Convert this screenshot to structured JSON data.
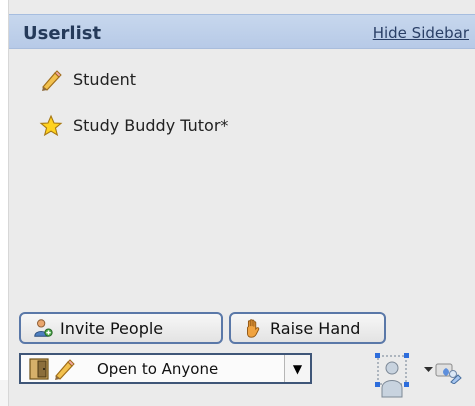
{
  "header": {
    "title": "Userlist",
    "hide_link": "Hide Sidebar"
  },
  "users": [
    {
      "name": "Student",
      "icon": "pencil-icon"
    },
    {
      "name": "Study Buddy Tutor*",
      "icon": "star-icon"
    }
  ],
  "buttons": {
    "invite": "Invite People",
    "raise_hand": "Raise Hand"
  },
  "access": {
    "selected": "Open to Anyone"
  },
  "colors": {
    "header_bg": "#b7cae7",
    "panel_bg": "#ebebeb",
    "button_border": "#5a78a8",
    "title": "#253a5a",
    "link": "#2a3f66"
  }
}
